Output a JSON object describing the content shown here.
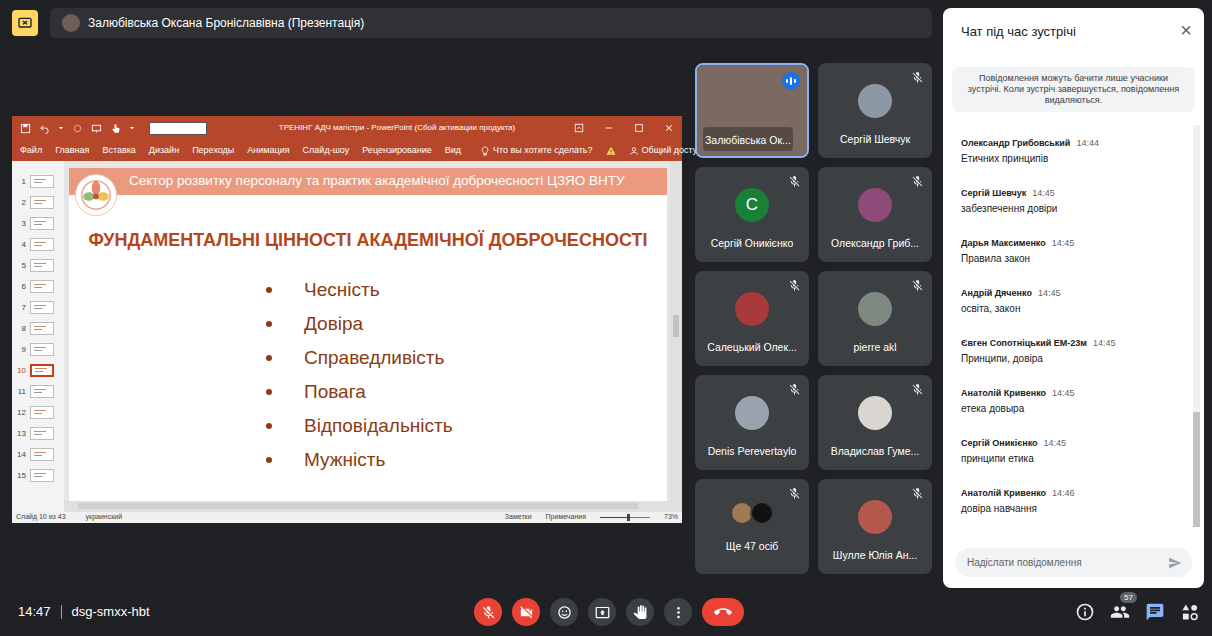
{
  "top_bar": {
    "presenter": "Залюбівська Оксана Броніславівна (Презентація)"
  },
  "presentation": {
    "app_title": "ТРЕНІНГ АДЧ магістри - PowerPoint (Сбой активации продукта)",
    "ribbon_tabs": [
      {
        "label": "Файл",
        "selected": false
      },
      {
        "label": "Главная",
        "selected": false
      },
      {
        "label": "Вставка",
        "selected": false
      },
      {
        "label": "Дизайн",
        "selected": false
      },
      {
        "label": "Переходы",
        "selected": false
      },
      {
        "label": "Анимация",
        "selected": false
      },
      {
        "label": "Слайд-шоу",
        "selected": false
      },
      {
        "label": "Рецензирование",
        "selected": false
      },
      {
        "label": "Вид",
        "selected": false
      }
    ],
    "search": "Что вы хотите сделать?",
    "share": "Общий доступ",
    "thumbnails": [
      {
        "number": "1",
        "selected": false
      },
      {
        "number": "2",
        "selected": false
      },
      {
        "number": "3",
        "selected": false
      },
      {
        "number": "4",
        "selected": false
      },
      {
        "number": "5",
        "selected": false
      },
      {
        "number": "6",
        "selected": false
      },
      {
        "number": "7",
        "selected": false
      },
      {
        "number": "8",
        "selected": false
      },
      {
        "number": "9",
        "selected": false
      },
      {
        "number": "10",
        "selected": true
      },
      {
        "number": "11",
        "selected": false
      },
      {
        "number": "12",
        "selected": false
      },
      {
        "number": "13",
        "selected": false
      },
      {
        "number": "14",
        "selected": false
      },
      {
        "number": "15",
        "selected": false
      }
    ],
    "slide": {
      "header": "Сектор розвитку персоналу та практик академічної доброчесності ЦЗЯО ВНТУ",
      "title": "ФУНДАМЕНТАЛЬНІ ЦІННОСТІ АКАДЕМІЧНОЇ ДОБРОЧЕСНОСТІ",
      "bullets": [
        "Чесність",
        "Довіра",
        "Справедливість",
        "Повага",
        "Відповідальність",
        "Мужність"
      ]
    },
    "status_bar": {
      "left": [
        "Слайд 10 из 43",
        "украинский"
      ],
      "right": [
        "Заметки",
        "Примечания"
      ],
      "zoom_slider": {
        "level": 0.55
      },
      "zoom": "73%"
    }
  },
  "participants": [
    {
      "name": "Залюбівська Ок...",
      "kind": "video",
      "muted": false,
      "speaking": true,
      "color": "#7a6a62"
    },
    {
      "name": "Сергій Шевчук",
      "kind": "photo",
      "muted": true,
      "speaking": false,
      "color": "#8c98a4"
    },
    {
      "name": "Сергій Оникієнко",
      "kind": "letter",
      "initial": "С",
      "muted": true,
      "speaking": false,
      "color": "#188038"
    },
    {
      "name": "Олександр Гриб...",
      "kind": "photo",
      "muted": true,
      "speaking": false,
      "color": "#8e4a78"
    },
    {
      "name": "Салецький Олек...",
      "kind": "photo",
      "muted": true,
      "speaking": false,
      "color": "#a83a3a"
    },
    {
      "name": "pierre akl",
      "kind": "photo",
      "muted": true,
      "speaking": false,
      "color": "#7c8880"
    },
    {
      "name": "Denis Perevertaylo",
      "kind": "photo",
      "muted": true,
      "speaking": false,
      "color": "#9aa4ae"
    },
    {
      "name": "Владислав Гуме...",
      "kind": "photo",
      "muted": true,
      "speaking": false,
      "color": "#d9d6d2"
    },
    {
      "name": "Ще 47 осіб",
      "kind": "more",
      "muted": true,
      "speaking": false,
      "color": "#a07a55",
      "second_color": "#111111"
    },
    {
      "name": "Шулле Юлія Ан...",
      "kind": "photo",
      "muted": true,
      "speaking": false,
      "color": "#b3584a"
    }
  ],
  "chat": {
    "title": "Чат під час зустрічі",
    "close": "×",
    "notice": "Повідомлення можуть бачити лише учасники зустрічі. Коли зустріч завершується, повідомлення видаляються.",
    "messages": [
      {
        "sender": "Олександр Грибовський",
        "time": "14:44",
        "text": "Етичних принципів"
      },
      {
        "sender": "Сергій Шевчук",
        "time": "14:45",
        "text": "забезпечення довіри"
      },
      {
        "sender": "Дарья Максименко",
        "time": "14:45",
        "text": "Правила закон"
      },
      {
        "sender": "Андрій Дяченко",
        "time": "14:45",
        "text": "освіта, закон"
      },
      {
        "sender": "Євген Сопотніцький ЕМ-23м",
        "time": "14:45",
        "text": "Принципи, довіра"
      },
      {
        "sender": "Анатолій Кривенко",
        "time": "14:45",
        "text": "етека довыра"
      },
      {
        "sender": "Сергій Оникієнко",
        "time": "14:45",
        "text": "принципи етика"
      },
      {
        "sender": "Анатолій Кривенко",
        "time": "14:46",
        "text": "довіра навчання"
      }
    ],
    "scrollbar": {
      "level": 1
    },
    "input_placeholder": "Надіслати повідомлення"
  },
  "bottom_bar": {
    "time": "14:47",
    "meeting_code": "dsg-smxx-hbt",
    "mic_on": false,
    "camera_on": false,
    "participant_count": "57",
    "chat_open": true
  }
}
